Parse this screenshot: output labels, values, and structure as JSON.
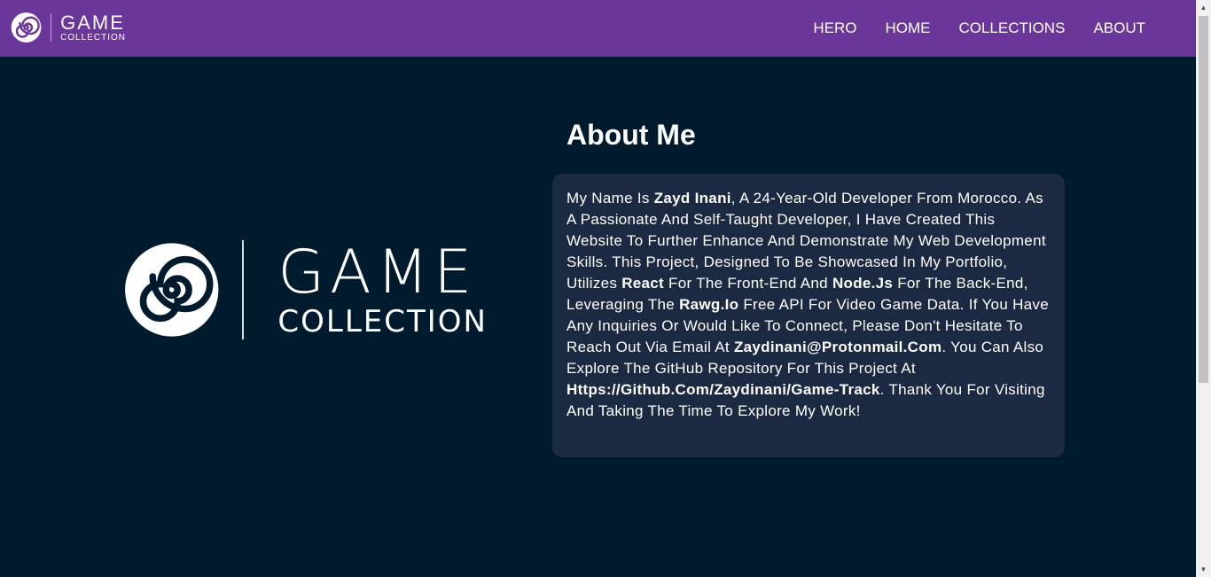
{
  "nav": {
    "logo": {
      "line1": "GAME",
      "line2": "COLLECTION"
    },
    "links": [
      "HERO",
      "HOME",
      "COLLECTIONS",
      "ABOUT"
    ]
  },
  "hero_logo": {
    "line1": "GAME",
    "line2": "COLLECTION"
  },
  "about": {
    "title": "About Me",
    "segments": [
      {
        "text": "My Name Is ",
        "bold": false
      },
      {
        "text": "Zayd Inani",
        "bold": true
      },
      {
        "text": ", A 24-Year-Old Developer From Morocco. As A Passionate And Self-Taught Developer, I Have Created This Website To Further Enhance And Demonstrate My Web Development Skills. This Project, Designed To Be Showcased In My Portfolio, Utilizes ",
        "bold": false
      },
      {
        "text": "React",
        "bold": true
      },
      {
        "text": " For The Front-End And ",
        "bold": false
      },
      {
        "text": "Node.Js",
        "bold": true
      },
      {
        "text": " For The Back-End, Leveraging The ",
        "bold": false
      },
      {
        "text": "Rawg.Io",
        "bold": true
      },
      {
        "text": " Free API For Video Game Data. If You Have Any Inquiries Or Would Like To Connect, Please Don't Hesitate To Reach Out Via Email At ",
        "bold": false
      },
      {
        "text": "Zaydinani@Protonmail.Com",
        "bold": true
      },
      {
        "text": ". You Can Also Explore The GitHub Repository For This Project At ",
        "bold": false
      },
      {
        "text": "Https://Github.Com/Zaydinani/Game-Track",
        "bold": true
      },
      {
        "text": ". Thank You For Visiting And Taking The Time To Explore My Work!",
        "bold": false
      }
    ]
  },
  "colors": {
    "navbar": "#6a369a",
    "background": "#001b2e",
    "card": "#1b2942",
    "text": "#ffffff"
  },
  "icons": {
    "logo_mark": "spiral-icon"
  }
}
